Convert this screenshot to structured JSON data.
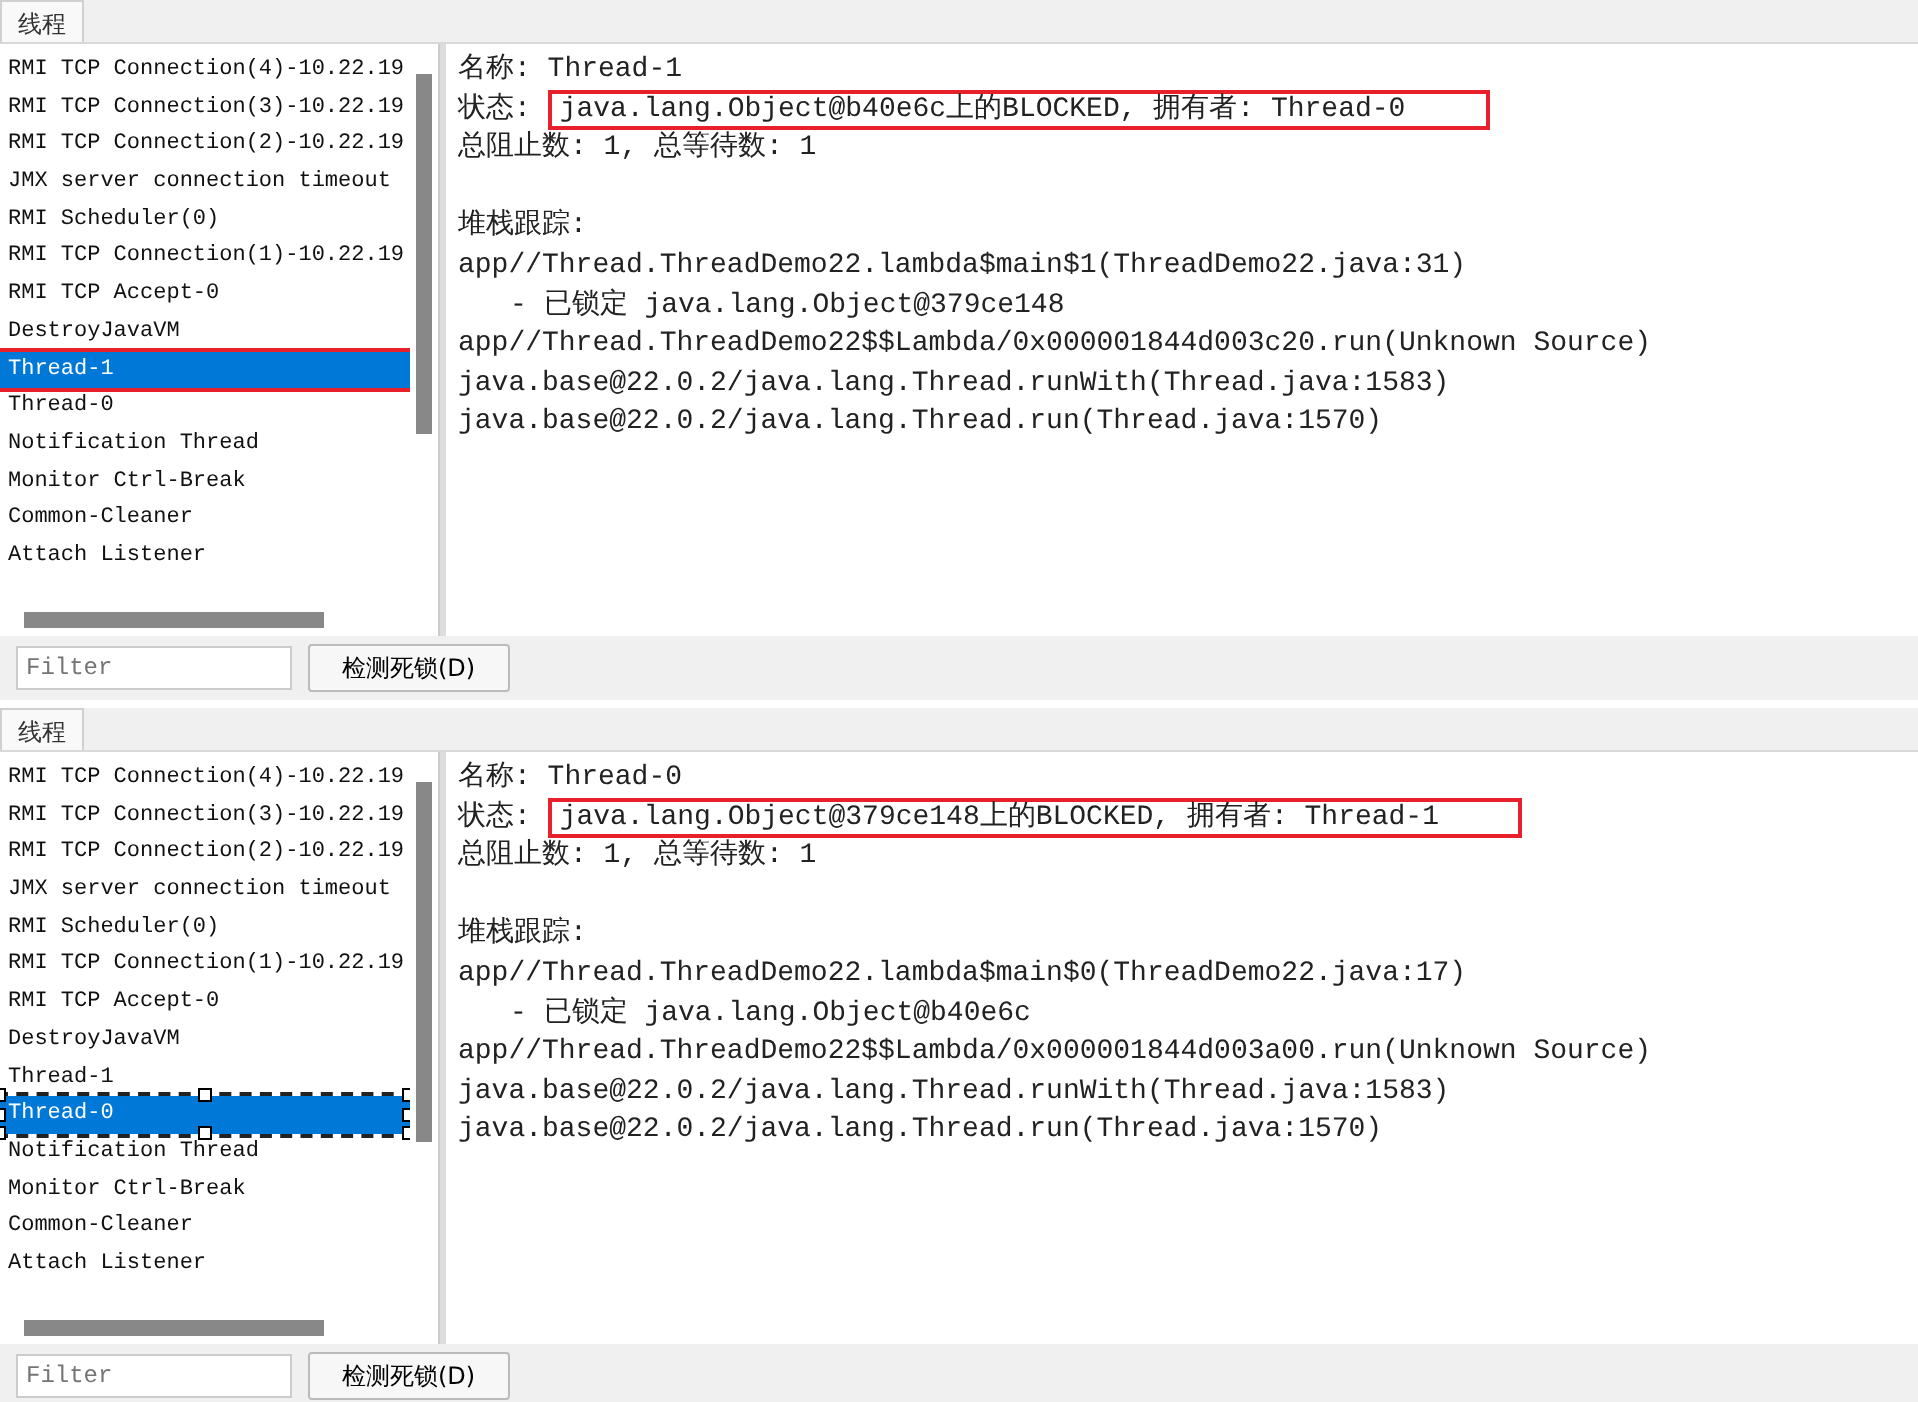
{
  "panels": [
    {
      "tab": {
        "label": "线程",
        "selected": true
      },
      "threads": [
        {
          "name": "RMI TCP Connection(4)-10.22.19",
          "selected": false,
          "boxed": false,
          "handles": false
        },
        {
          "name": "RMI TCP Connection(3)-10.22.19",
          "selected": false,
          "boxed": false,
          "handles": false
        },
        {
          "name": "RMI TCP Connection(2)-10.22.19",
          "selected": false,
          "boxed": false,
          "handles": false
        },
        {
          "name": "JMX server connection timeout",
          "selected": false,
          "boxed": false,
          "handles": false
        },
        {
          "name": "RMI Scheduler(0)",
          "selected": false,
          "boxed": false,
          "handles": false
        },
        {
          "name": "RMI TCP Connection(1)-10.22.19",
          "selected": false,
          "boxed": false,
          "handles": false
        },
        {
          "name": "RMI TCP Accept-0",
          "selected": false,
          "boxed": false,
          "handles": false
        },
        {
          "name": "DestroyJavaVM",
          "selected": false,
          "boxed": false,
          "handles": false
        },
        {
          "name": "Thread-1",
          "selected": true,
          "boxed": true,
          "handles": false
        },
        {
          "name": "Thread-0",
          "selected": false,
          "boxed": false,
          "handles": false
        },
        {
          "name": "Notification Thread",
          "selected": false,
          "boxed": false,
          "handles": false
        },
        {
          "name": "Monitor Ctrl-Break",
          "selected": false,
          "boxed": false,
          "handles": false
        },
        {
          "name": "Common-Cleaner",
          "selected": false,
          "boxed": false,
          "handles": false
        },
        {
          "name": "Attach Listener",
          "selected": false,
          "boxed": false,
          "handles": false
        }
      ],
      "details": {
        "name_line": "名称: Thread-1",
        "state_label": "状态: ",
        "state_value": "java.lang.Object@b40e6c上的BLOCKED, 拥有者: Thread-0",
        "state_highlighted": true,
        "counts_line": "总阻止数: 1, 总等待数: 1",
        "stack_heading": "堆栈跟踪:",
        "stack": [
          {
            "text": "app//Thread.ThreadDemo22.lambda$main$1(ThreadDemo22.java:31)",
            "kind": "frame"
          },
          {
            "text": "- 已锁定 java.lang.Object@379ce148",
            "kind": "lock"
          },
          {
            "text": "app//Thread.ThreadDemo22$$Lambda/0x000001844d003c20.run(Unknown Source)",
            "kind": "frame"
          },
          {
            "text": "java.base@22.0.2/java.lang.Thread.runWith(Thread.java:1583)",
            "kind": "frame"
          },
          {
            "text": "java.base@22.0.2/java.lang.Thread.run(Thread.java:1570)",
            "kind": "frame"
          }
        ]
      },
      "filter": {
        "placeholder": "Filter"
      },
      "detect_button": "检测死锁(D)"
    },
    {
      "tab": {
        "label": "线程",
        "selected": true
      },
      "threads": [
        {
          "name": "RMI TCP Connection(4)-10.22.19",
          "selected": false,
          "boxed": false,
          "handles": false
        },
        {
          "name": "RMI TCP Connection(3)-10.22.19",
          "selected": false,
          "boxed": false,
          "handles": false
        },
        {
          "name": "RMI TCP Connection(2)-10.22.19",
          "selected": false,
          "boxed": false,
          "handles": false
        },
        {
          "name": "JMX server connection timeout",
          "selected": false,
          "boxed": false,
          "handles": false
        },
        {
          "name": "RMI Scheduler(0)",
          "selected": false,
          "boxed": false,
          "handles": false
        },
        {
          "name": "RMI TCP Connection(1)-10.22.19",
          "selected": false,
          "boxed": false,
          "handles": false
        },
        {
          "name": "RMI TCP Accept-0",
          "selected": false,
          "boxed": false,
          "handles": false
        },
        {
          "name": "DestroyJavaVM",
          "selected": false,
          "boxed": false,
          "handles": false
        },
        {
          "name": "Thread-1",
          "selected": false,
          "boxed": false,
          "handles": false
        },
        {
          "name": "Thread-0",
          "selected": true,
          "boxed": false,
          "handles": true
        },
        {
          "name": "Notification Thread",
          "selected": false,
          "boxed": false,
          "handles": false
        },
        {
          "name": "Monitor Ctrl-Break",
          "selected": false,
          "boxed": false,
          "handles": false
        },
        {
          "name": "Common-Cleaner",
          "selected": false,
          "boxed": false,
          "handles": false
        },
        {
          "name": "Attach Listener",
          "selected": false,
          "boxed": false,
          "handles": false
        }
      ],
      "details": {
        "name_line": "名称: Thread-0",
        "state_label": "状态: ",
        "state_value": "java.lang.Object@379ce148上的BLOCKED, 拥有者: Thread-1",
        "state_highlighted": true,
        "counts_line": "总阻止数: 1, 总等待数: 1",
        "stack_heading": "堆栈跟踪:",
        "stack": [
          {
            "text": "app//Thread.ThreadDemo22.lambda$main$0(ThreadDemo22.java:17)",
            "kind": "frame"
          },
          {
            "text": "- 已锁定 java.lang.Object@b40e6c",
            "kind": "lock"
          },
          {
            "text": "app//Thread.ThreadDemo22$$Lambda/0x000001844d003a00.run(Unknown Source)",
            "kind": "frame"
          },
          {
            "text": "java.base@22.0.2/java.lang.Thread.runWith(Thread.java:1583)",
            "kind": "frame"
          },
          {
            "text": "java.base@22.0.2/java.lang.Thread.run(Thread.java:1570)",
            "kind": "frame"
          }
        ]
      },
      "filter": {
        "placeholder": "Filter"
      },
      "detect_button": "检测死锁(D)"
    }
  ]
}
